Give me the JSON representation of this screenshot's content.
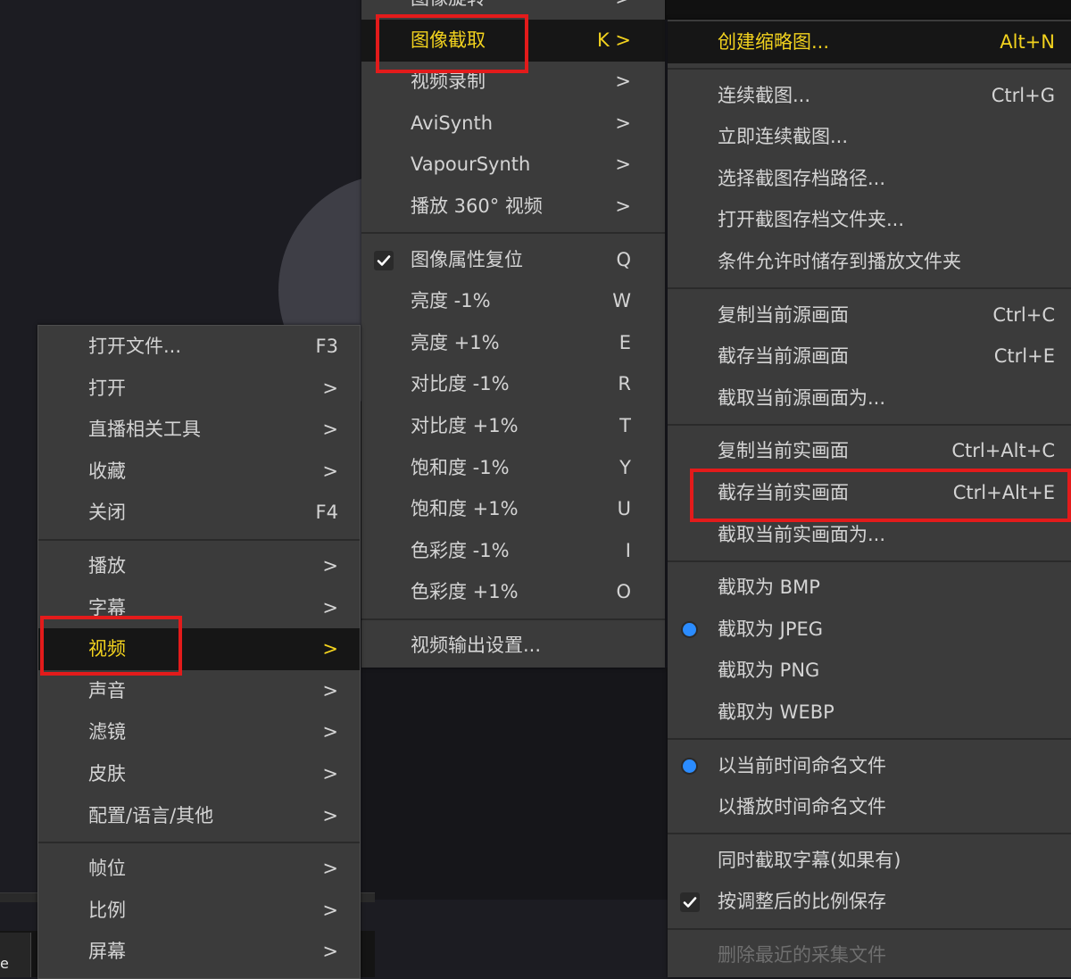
{
  "menu_main": {
    "groups": [
      [
        {
          "label": "打开文件...",
          "shortcut": "F3"
        },
        {
          "label": "打开",
          "shortcut": ">"
        },
        {
          "label": "直播相关工具",
          "shortcut": ">"
        },
        {
          "label": "收藏",
          "shortcut": ">"
        },
        {
          "label": "关闭",
          "shortcut": "F4"
        }
      ],
      [
        {
          "label": "播放",
          "shortcut": ">"
        },
        {
          "label": "字幕",
          "shortcut": ">"
        },
        {
          "label": "视频",
          "shortcut": ">",
          "active": true
        },
        {
          "label": "声音",
          "shortcut": ">"
        },
        {
          "label": "滤镜",
          "shortcut": ">"
        },
        {
          "label": "皮肤",
          "shortcut": ">"
        },
        {
          "label": "配置/语言/其他",
          "shortcut": ">"
        }
      ],
      [
        {
          "label": "帧位",
          "shortcut": ">"
        },
        {
          "label": "比例",
          "shortcut": ">"
        },
        {
          "label": "屏幕",
          "shortcut": ">"
        }
      ]
    ]
  },
  "menu_video": {
    "groups": [
      [
        {
          "label": "图像旋转",
          "shortcut": ">"
        },
        {
          "label": "图像截取",
          "shortcut": "K >",
          "active": true
        },
        {
          "label": "视频录制",
          "shortcut": ">"
        },
        {
          "label": "AviSynth",
          "shortcut": ">"
        },
        {
          "label": "VapourSynth",
          "shortcut": ">"
        },
        {
          "label": "播放 360° 视频",
          "shortcut": ">"
        }
      ],
      [
        {
          "label": "图像属性复位",
          "shortcut": "Q",
          "checked": true
        },
        {
          "label": "亮度 -1%",
          "shortcut": "W"
        },
        {
          "label": "亮度 +1%",
          "shortcut": "E"
        },
        {
          "label": "对比度 -1%",
          "shortcut": "R"
        },
        {
          "label": "对比度 +1%",
          "shortcut": "T"
        },
        {
          "label": "饱和度 -1%",
          "shortcut": "Y"
        },
        {
          "label": "饱和度 +1%",
          "shortcut": "U"
        },
        {
          "label": "色彩度 -1%",
          "shortcut": "I"
        },
        {
          "label": "色彩度 +1%",
          "shortcut": "O"
        }
      ],
      [
        {
          "label": "视频输出设置...",
          "shortcut": ""
        }
      ]
    ]
  },
  "menu_capture": {
    "groups": [
      [
        {
          "label": "创建缩略图...",
          "shortcut": "Alt+N",
          "active": true
        }
      ],
      [
        {
          "label": "连续截图...",
          "shortcut": "Ctrl+G"
        },
        {
          "label": "立即连续截图...",
          "shortcut": ""
        },
        {
          "label": "选择截图存档路径...",
          "shortcut": ""
        },
        {
          "label": "打开截图存档文件夹...",
          "shortcut": ""
        },
        {
          "label": "条件允许时储存到播放文件夹",
          "shortcut": ""
        }
      ],
      [
        {
          "label": "复制当前源画面",
          "shortcut": "Ctrl+C"
        },
        {
          "label": "截存当前源画面",
          "shortcut": "Ctrl+E"
        },
        {
          "label": "截取当前源画面为...",
          "shortcut": ""
        }
      ],
      [
        {
          "label": "复制当前实画面",
          "shortcut": "Ctrl+Alt+C"
        },
        {
          "label": "截存当前实画面",
          "shortcut": "Ctrl+Alt+E"
        },
        {
          "label": "截取当前实画面为...",
          "shortcut": ""
        }
      ],
      [
        {
          "label": "截取为 BMP",
          "shortcut": ""
        },
        {
          "label": "截取为 JPEG",
          "shortcut": "",
          "radio": true
        },
        {
          "label": "截取为 PNG",
          "shortcut": ""
        },
        {
          "label": "截取为 WEBP",
          "shortcut": ""
        }
      ],
      [
        {
          "label": "以当前时间命名文件",
          "shortcut": "",
          "radio": true
        },
        {
          "label": "以播放时间命名文件",
          "shortcut": ""
        }
      ],
      [
        {
          "label": "同时截取字幕(如果有)",
          "shortcut": ""
        },
        {
          "label": "按调整后的比例保存",
          "shortcut": "",
          "checked": true
        }
      ],
      [
        {
          "label": "删除最近的采集文件",
          "shortcut": "",
          "disabled": true
        }
      ]
    ]
  },
  "background": {
    "tab_letter": "e"
  },
  "colors": {
    "active_text": "#f2d21e",
    "highlight_box": "#e31b1b",
    "radio_dot": "#2b8cff",
    "menu_bg": "#3b3b3b"
  }
}
